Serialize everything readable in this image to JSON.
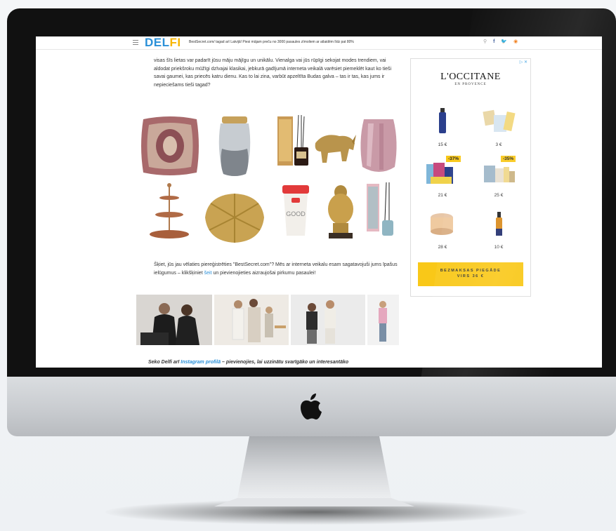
{
  "site": {
    "logo": "DELFI",
    "topbar_news": "BestSecret.com/ tagad arī Latvijā! Piesi mājam preču no 3000 pasaules zīmoliem ar atlaidēm līdz pat 80%",
    "social_icons": [
      "search-icon",
      "facebook-icon",
      "twitter-icon",
      "rss-icon"
    ]
  },
  "article": {
    "intro_text": "visas šīs lietas var padarīt jūsu māju mājīgu un unikālu. Vienalga vai jūs rūpīgi sekojat modes trendiem, vai aldodat priekšroku mūžīgi dzīvajai klasikai, jebkurā gadījumā interneta veikalā varēsiet piemeklēt kaut ko tieši savai gaumei, kas priecēs katru dienu. Kas to lai zina, varbūt apzeltīta Budas galva – tas ir tas, kas jums ir nepieciešams tieši tagad?",
    "question_text_before": "Šķiet, jūs jau vēlaties piereģistrēties \"BestSecret.com\"? Mēs ar interneta veikalu esam sagatavojuši jums īpašus ielūgumus – klikšķiniet ",
    "question_link": "šeit",
    "question_text_after": " un pievienojieties aizraujošai pirkumu pasaulei!",
    "footer_before": "Seko Delfi arī ",
    "footer_link": "Instagram profilā",
    "footer_after": " – pievienojies, lai uzzinātu svarīgāko un interesantāko"
  },
  "products": [
    "paisley-cushion",
    "glass-vase",
    "reed-diffuser-box",
    "gold-rhino-figurine",
    "pink-glass-vase",
    "tiered-cake-stand",
    "gold-leaf-dish",
    "good-morning-travel-cup",
    "gold-buddha-head",
    "floral-diffuser"
  ],
  "photos": [
    "couple-leather-jackets",
    "family-white-outfits",
    "couple-studio",
    "woman-pink-outfit"
  ],
  "ad": {
    "close_label": "▷ ✕",
    "brand": "L'OCCITANE",
    "subtitle": "EN PROVENCE",
    "items": [
      {
        "price": "15 €",
        "badge": ""
      },
      {
        "price": "3 €",
        "badge": ""
      },
      {
        "price": "21 €",
        "badge": "-37%"
      },
      {
        "price": "25 €",
        "badge": "-35%"
      },
      {
        "price": "28 €",
        "badge": ""
      },
      {
        "price": "10 €",
        "badge": ""
      }
    ],
    "cta_line1": "BEZMAKSAS PIEGĀDE",
    "cta_line2": "VIRS 36 €"
  },
  "colors": {
    "brand_blue": "#2a90d8",
    "brand_yellow": "#f7b500",
    "ad_yellow": "#f9c818"
  }
}
